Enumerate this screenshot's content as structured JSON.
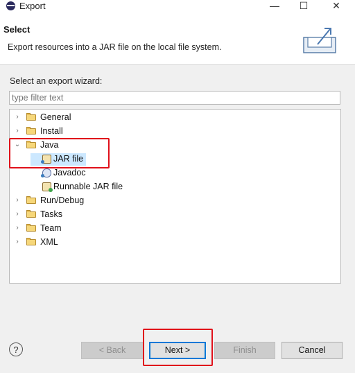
{
  "window": {
    "title": "Export",
    "minimize_glyph": "—",
    "maximize_glyph": "☐",
    "close_glyph": "✕"
  },
  "header": {
    "title": "Select",
    "description": "Export resources into a JAR file on the local file system."
  },
  "wizard": {
    "label": "Select an export wizard:",
    "filter_placeholder": "type filter text"
  },
  "tree": {
    "items": [
      {
        "label": "General",
        "type": "folder",
        "expanded": false
      },
      {
        "label": "Install",
        "type": "folder",
        "expanded": false
      },
      {
        "label": "Java",
        "type": "folder",
        "expanded": true
      },
      {
        "label": "JAR file",
        "type": "jar",
        "selected": true
      },
      {
        "label": "Javadoc",
        "type": "javadoc"
      },
      {
        "label": "Runnable JAR file",
        "type": "runnable-jar"
      },
      {
        "label": "Run/Debug",
        "type": "folder",
        "expanded": false
      },
      {
        "label": "Tasks",
        "type": "folder",
        "expanded": false
      },
      {
        "label": "Team",
        "type": "folder",
        "expanded": false
      },
      {
        "label": "XML",
        "type": "folder",
        "expanded": false
      }
    ]
  },
  "buttons": {
    "help": "?",
    "back": "< Back",
    "next": "Next >",
    "finish": "Finish",
    "cancel": "Cancel"
  },
  "colors": {
    "annotation": "#e0101a",
    "selection": "#cce8ff"
  }
}
